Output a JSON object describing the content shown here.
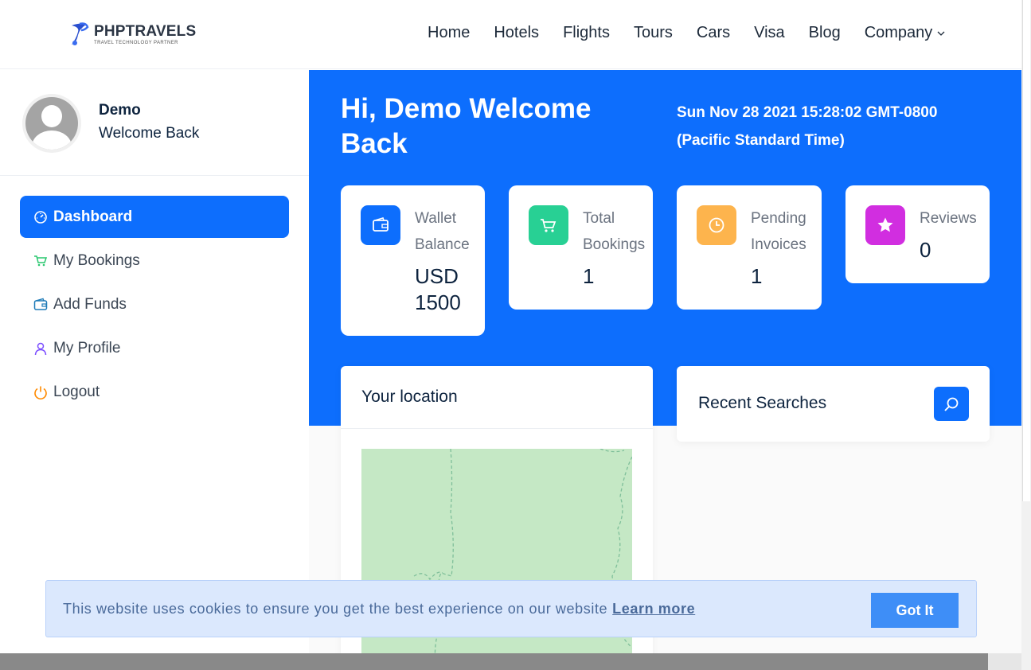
{
  "brand": {
    "name": "PHPTRAVELS",
    "tagline": "TRAVEL TECHNOLOGY PARTNER",
    "color": "#0d6efd"
  },
  "nav": {
    "items": [
      {
        "label": "Home"
      },
      {
        "label": "Hotels"
      },
      {
        "label": "Flights"
      },
      {
        "label": "Tours"
      },
      {
        "label": "Cars"
      },
      {
        "label": "Visa"
      },
      {
        "label": "Blog"
      },
      {
        "label": "Company",
        "icon": "chevron-down-icon"
      }
    ]
  },
  "profile": {
    "name": "Demo",
    "subtitle": "Welcome Back"
  },
  "sidebar": {
    "items": [
      {
        "label": "Dashboard",
        "icon": "dashboard-gauge-icon",
        "active": true
      },
      {
        "label": "My Bookings",
        "icon": "cart-icon",
        "icon_color": "#28c76f"
      },
      {
        "label": "Add Funds",
        "icon": "wallet-icon",
        "icon_color": "#1e7bb8"
      },
      {
        "label": "My Profile",
        "icon": "user-icon",
        "icon_color": "#7b4dff"
      },
      {
        "label": "Logout",
        "icon": "power-icon",
        "icon_color": "#ff8a00"
      }
    ]
  },
  "hero": {
    "greeting": "Hi, Demo Welcome Back",
    "date_line1": "Sun Nov 28 2021 15:28:02 GMT-0800",
    "date_line2": "(Pacific Standard Time)"
  },
  "stats": [
    {
      "label_line1": "Wallet",
      "label_line2": "Balance",
      "value_line1": "USD",
      "value_line2": "1500",
      "icon": "wallet-icon",
      "color": "#0d6efd"
    },
    {
      "label_line1": "Total",
      "label_line2": "Bookings",
      "value": "1",
      "icon": "cart-icon",
      "color": "#28d094"
    },
    {
      "label_line1": "Pending",
      "label_line2": "Invoices",
      "value": "1",
      "icon": "clock-icon",
      "color": "#fdb44d"
    },
    {
      "label_line1": "Reviews",
      "value": "0",
      "icon": "star-icon",
      "color": "#d12ee0"
    }
  ],
  "location": {
    "title": "Your location"
  },
  "recent_searches": {
    "title": "Recent Searches",
    "icon": "search-icon"
  },
  "cookie": {
    "text": "This website uses cookies to ensure you get the best experience on our website",
    "link": "Learn more",
    "button": "Got It"
  }
}
